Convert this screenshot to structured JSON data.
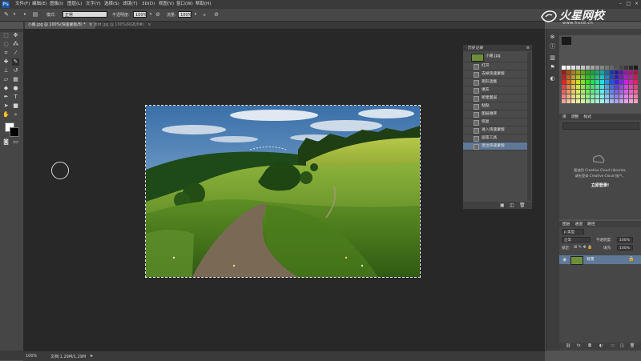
{
  "app": {
    "logo": "Ps"
  },
  "menu": [
    "文件(F)",
    "编辑(E)",
    "图像(I)",
    "图层(L)",
    "文字(Y)",
    "选择(S)",
    "滤镜(T)",
    "3D(D)",
    "视图(V)",
    "窗口(W)",
    "帮助(H)"
  ],
  "window_controls": [
    "–",
    "□",
    "×"
  ],
  "options": {
    "mode_label": "模式:",
    "mode_value": "正常",
    "opacity_label": "不透明度:",
    "opacity_value": "100%",
    "flow_label": "流量:",
    "flow_value": "100%"
  },
  "brand": {
    "name": "火星网校",
    "url": "www.hxsd.cn"
  },
  "tabs": [
    {
      "label": "小路.jpg @ 100%(快速蒙版/8) *",
      "active": true
    },
    {
      "label": "素材.jpg @ 100%(RGB/8#)",
      "active": false
    }
  ],
  "history": {
    "title": "历史记录",
    "snapshot": "小路.jpg",
    "items": [
      "打开",
      "去掉快速蒙版",
      "矩形选框",
      "填充",
      "新建图层",
      "粘贴",
      "图层顺序",
      "恢复",
      "进入快速蒙版",
      "画笔工具",
      "退出快速蒙版"
    ],
    "selected_index": 10
  },
  "libraries": {
    "tabs": [
      "库",
      "调整",
      "样式"
    ],
    "message_1": "要使用 Creative Cloud Libraries,",
    "message_2": "请先登录 Creative Cloud 账户。",
    "login": "立即登录!"
  },
  "layers": {
    "tabs": [
      "图层",
      "通道",
      "路径"
    ],
    "filter_label": "p 类型",
    "blend_mode": "正常",
    "opacity_label": "不透明度:",
    "opacity_value": "100%",
    "lock_label": "锁定:",
    "fill_label": "填充:",
    "fill_value": "100%",
    "layer_name": "背景"
  },
  "status": {
    "zoom": "100%",
    "doc_info": "文档:1.29M/1.29M"
  },
  "colors": {
    "accent": "#5f7897",
    "bg": "#535353",
    "canvas": "#282828"
  }
}
